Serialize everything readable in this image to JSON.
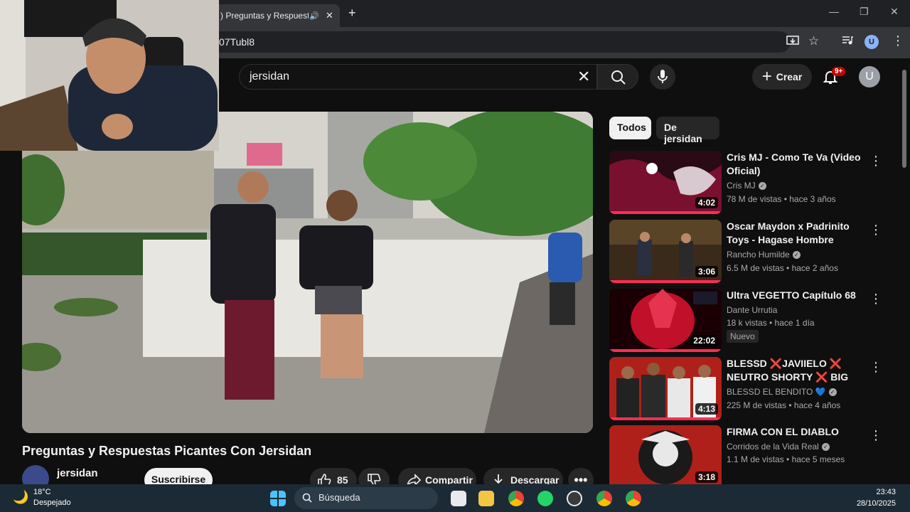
{
  "browser": {
    "tab_title": ") Preguntas y Respuestas",
    "url_fragment": "07Tubl8",
    "profile_initial": "U"
  },
  "header": {
    "search_value": "jersidan",
    "create_label": "Crear",
    "notifications_count": "9+",
    "avatar_initial": "U"
  },
  "video": {
    "title": "Preguntas y Respuestas Picantes Con Jersidan",
    "channel": "jersidan",
    "subscribe_label": "Suscribirse",
    "likes": "85",
    "share_label": "Compartir",
    "download_label": "Descargar"
  },
  "sidebar": {
    "chips": [
      "Todos",
      "De jersidan"
    ],
    "items": [
      {
        "title": "Cris MJ - Como Te Va (Video Oficial)",
        "channel": "Cris MJ",
        "verified": true,
        "meta": "78 M de vistas • hace 3 años",
        "duration": "4:02",
        "badge": ""
      },
      {
        "title": "Oscar Maydon x Padrinito Toys - Hagase Hombre [Official Video]",
        "channel": "Rancho Humilde",
        "verified": true,
        "meta": "6.5 M de vistas • hace 2 años",
        "duration": "3:06",
        "badge": ""
      },
      {
        "title": "Ultra VEGETTO Capítulo 68",
        "channel": "Dante Urrutia",
        "verified": false,
        "meta": "18 k vistas • hace 1 día",
        "duration": "22:02",
        "badge": "Nuevo"
      },
      {
        "title": "BLESSD ❌JAVIIELO ❌ NEUTRO SHORTY ❌ BIG SOT...",
        "channel": "BLESSD EL BENDITO 💙",
        "verified": true,
        "meta": "225 M de vistas • hace 4 años",
        "duration": "4:13",
        "badge": ""
      },
      {
        "title": "FIRMA CON EL DIABLO",
        "channel": "Corridos de la Vida Real",
        "verified": true,
        "meta": "1.1 M de vistas • hace 5 meses",
        "duration": "3:18",
        "badge": ""
      }
    ]
  },
  "taskbar": {
    "temperature": "18°C",
    "weather": "Despejado",
    "search_label": "Búsqueda",
    "time": "23:43",
    "date": "28/10/2025"
  },
  "colors": {
    "background": "#0f0f0f",
    "accent_red": "#ff0000",
    "progress": "#ff2d55",
    "taskbar": "#1c2a36"
  }
}
